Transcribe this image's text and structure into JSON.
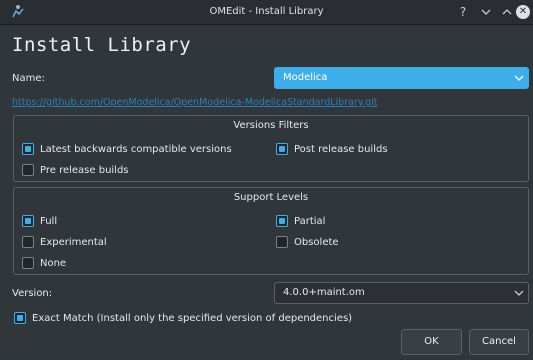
{
  "window": {
    "title": "OMEdit - Install Library",
    "icon": "omedit-logo-icon"
  },
  "heading": "Install Library",
  "name_field": {
    "label": "Name:",
    "value": "Modelica",
    "accent": "#3daee9"
  },
  "url": "https://github.com/OpenModelica/OpenModelica-ModelicaStandardLibrary.git",
  "versions_filters": {
    "title": "Versions Filters",
    "latest_compatible": {
      "label": "Latest backwards compatible versions",
      "checked": true
    },
    "post_release": {
      "label": "Post release builds",
      "checked": true
    },
    "pre_release": {
      "label": "Pre release builds",
      "checked": false
    }
  },
  "support_levels": {
    "title": "Support Levels",
    "full": {
      "label": "Full",
      "checked": true
    },
    "partial": {
      "label": "Partial",
      "checked": true
    },
    "experimental": {
      "label": "Experimental",
      "checked": false
    },
    "obsolete": {
      "label": "Obsolete",
      "checked": false
    },
    "none": {
      "label": "None",
      "checked": false
    }
  },
  "version_field": {
    "label": "Version:",
    "value": "4.0.0+maint.om"
  },
  "exact_match": {
    "label": "Exact Match (Install only the specified version of dependencies)",
    "checked": true
  },
  "buttons": {
    "ok": "OK",
    "cancel": "Cancel"
  }
}
